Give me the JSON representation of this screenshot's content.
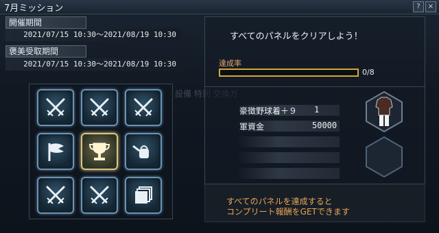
{
  "window": {
    "title": "7月ミッション",
    "help_label": "?",
    "close_label": "×"
  },
  "left": {
    "event_period_label": "開催期間",
    "event_period_value": "2021/07/15 10:30～2021/08/19 10:30",
    "reward_period_label": "褒美受取期間",
    "reward_period_value": "2021/07/15 10:30～2021/08/19 10:30",
    "background_text": "設備 特別 交換ガ",
    "panels": [
      {
        "icon": "crossed-swords-icon"
      },
      {
        "icon": "crossed-swords-icon"
      },
      {
        "icon": "crossed-swords-icon"
      },
      {
        "icon": "flag-icon"
      },
      {
        "icon": "trophy-icon"
      },
      {
        "icon": "watering-can-icon"
      },
      {
        "icon": "crossed-swords-icon"
      },
      {
        "icon": "crossed-swords-icon"
      },
      {
        "icon": "stacked-cards-icon"
      }
    ]
  },
  "right": {
    "mission_text": "すべてのパネルをクリアしよう！",
    "achievement_label": "達成率",
    "progress_text": "0/8",
    "progress": {
      "current": 0,
      "total": 8
    },
    "rewards": [
      {
        "name": "豪徴野球着＋９",
        "qty": "1"
      },
      {
        "name": "軍資金",
        "qty": "50000"
      }
    ],
    "footer_line1": "すべてのパネルを達成すると",
    "footer_line2": "コンプリート報酬をGETできます"
  },
  "colors": {
    "accent_gold": "#d2a93b",
    "footer_orange": "#e8a75a",
    "achievement_orange": "#e6a86a"
  }
}
